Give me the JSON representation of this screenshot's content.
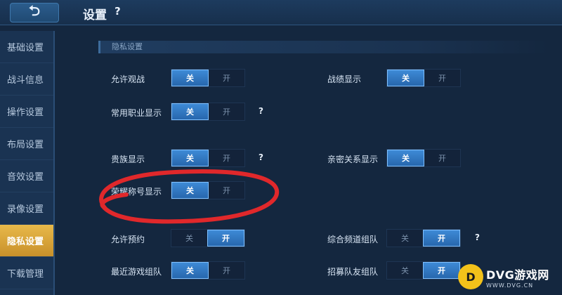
{
  "header": {
    "title": "设置",
    "help": "?",
    "back_icon": "back-arrow-icon"
  },
  "sidebar": {
    "items": [
      {
        "label": "基础设置"
      },
      {
        "label": "战斗信息"
      },
      {
        "label": "操作设置"
      },
      {
        "label": "布局设置"
      },
      {
        "label": "音效设置"
      },
      {
        "label": "录像设置"
      },
      {
        "label": "隐私设置",
        "active": true
      },
      {
        "label": "下载管理"
      }
    ]
  },
  "section": {
    "title": "隐私设置"
  },
  "toggle_labels": {
    "off": "关",
    "on": "开"
  },
  "settings": {
    "allow_spectate": {
      "label": "允许观战",
      "value": "关"
    },
    "record_display": {
      "label": "战绩显示",
      "value": "关"
    },
    "common_role_display": {
      "label": "常用职业显示",
      "value": "关"
    },
    "noble_display": {
      "label": "贵族显示",
      "value": "关"
    },
    "intimate_display": {
      "label": "亲密关系显示",
      "value": "关"
    },
    "honor_title_display": {
      "label": "荣耀称号显示",
      "value": "关"
    },
    "allow_reservation": {
      "label": "允许预约",
      "value": "开"
    },
    "channel_team": {
      "label": "综合频道组队",
      "value": "开"
    },
    "recent_team": {
      "label": "最近游戏组队",
      "value": "关"
    },
    "recruit_team": {
      "label": "招募队友组队",
      "value": "开"
    }
  },
  "help_mark": "?",
  "colors": {
    "accent_on": "#2f78c4",
    "active_tab": "#d9a53b",
    "annotation": "#e0282b"
  },
  "watermark": {
    "logo": "D",
    "main": "DVG游戏网",
    "sub": "WWW.DVG.CN"
  }
}
